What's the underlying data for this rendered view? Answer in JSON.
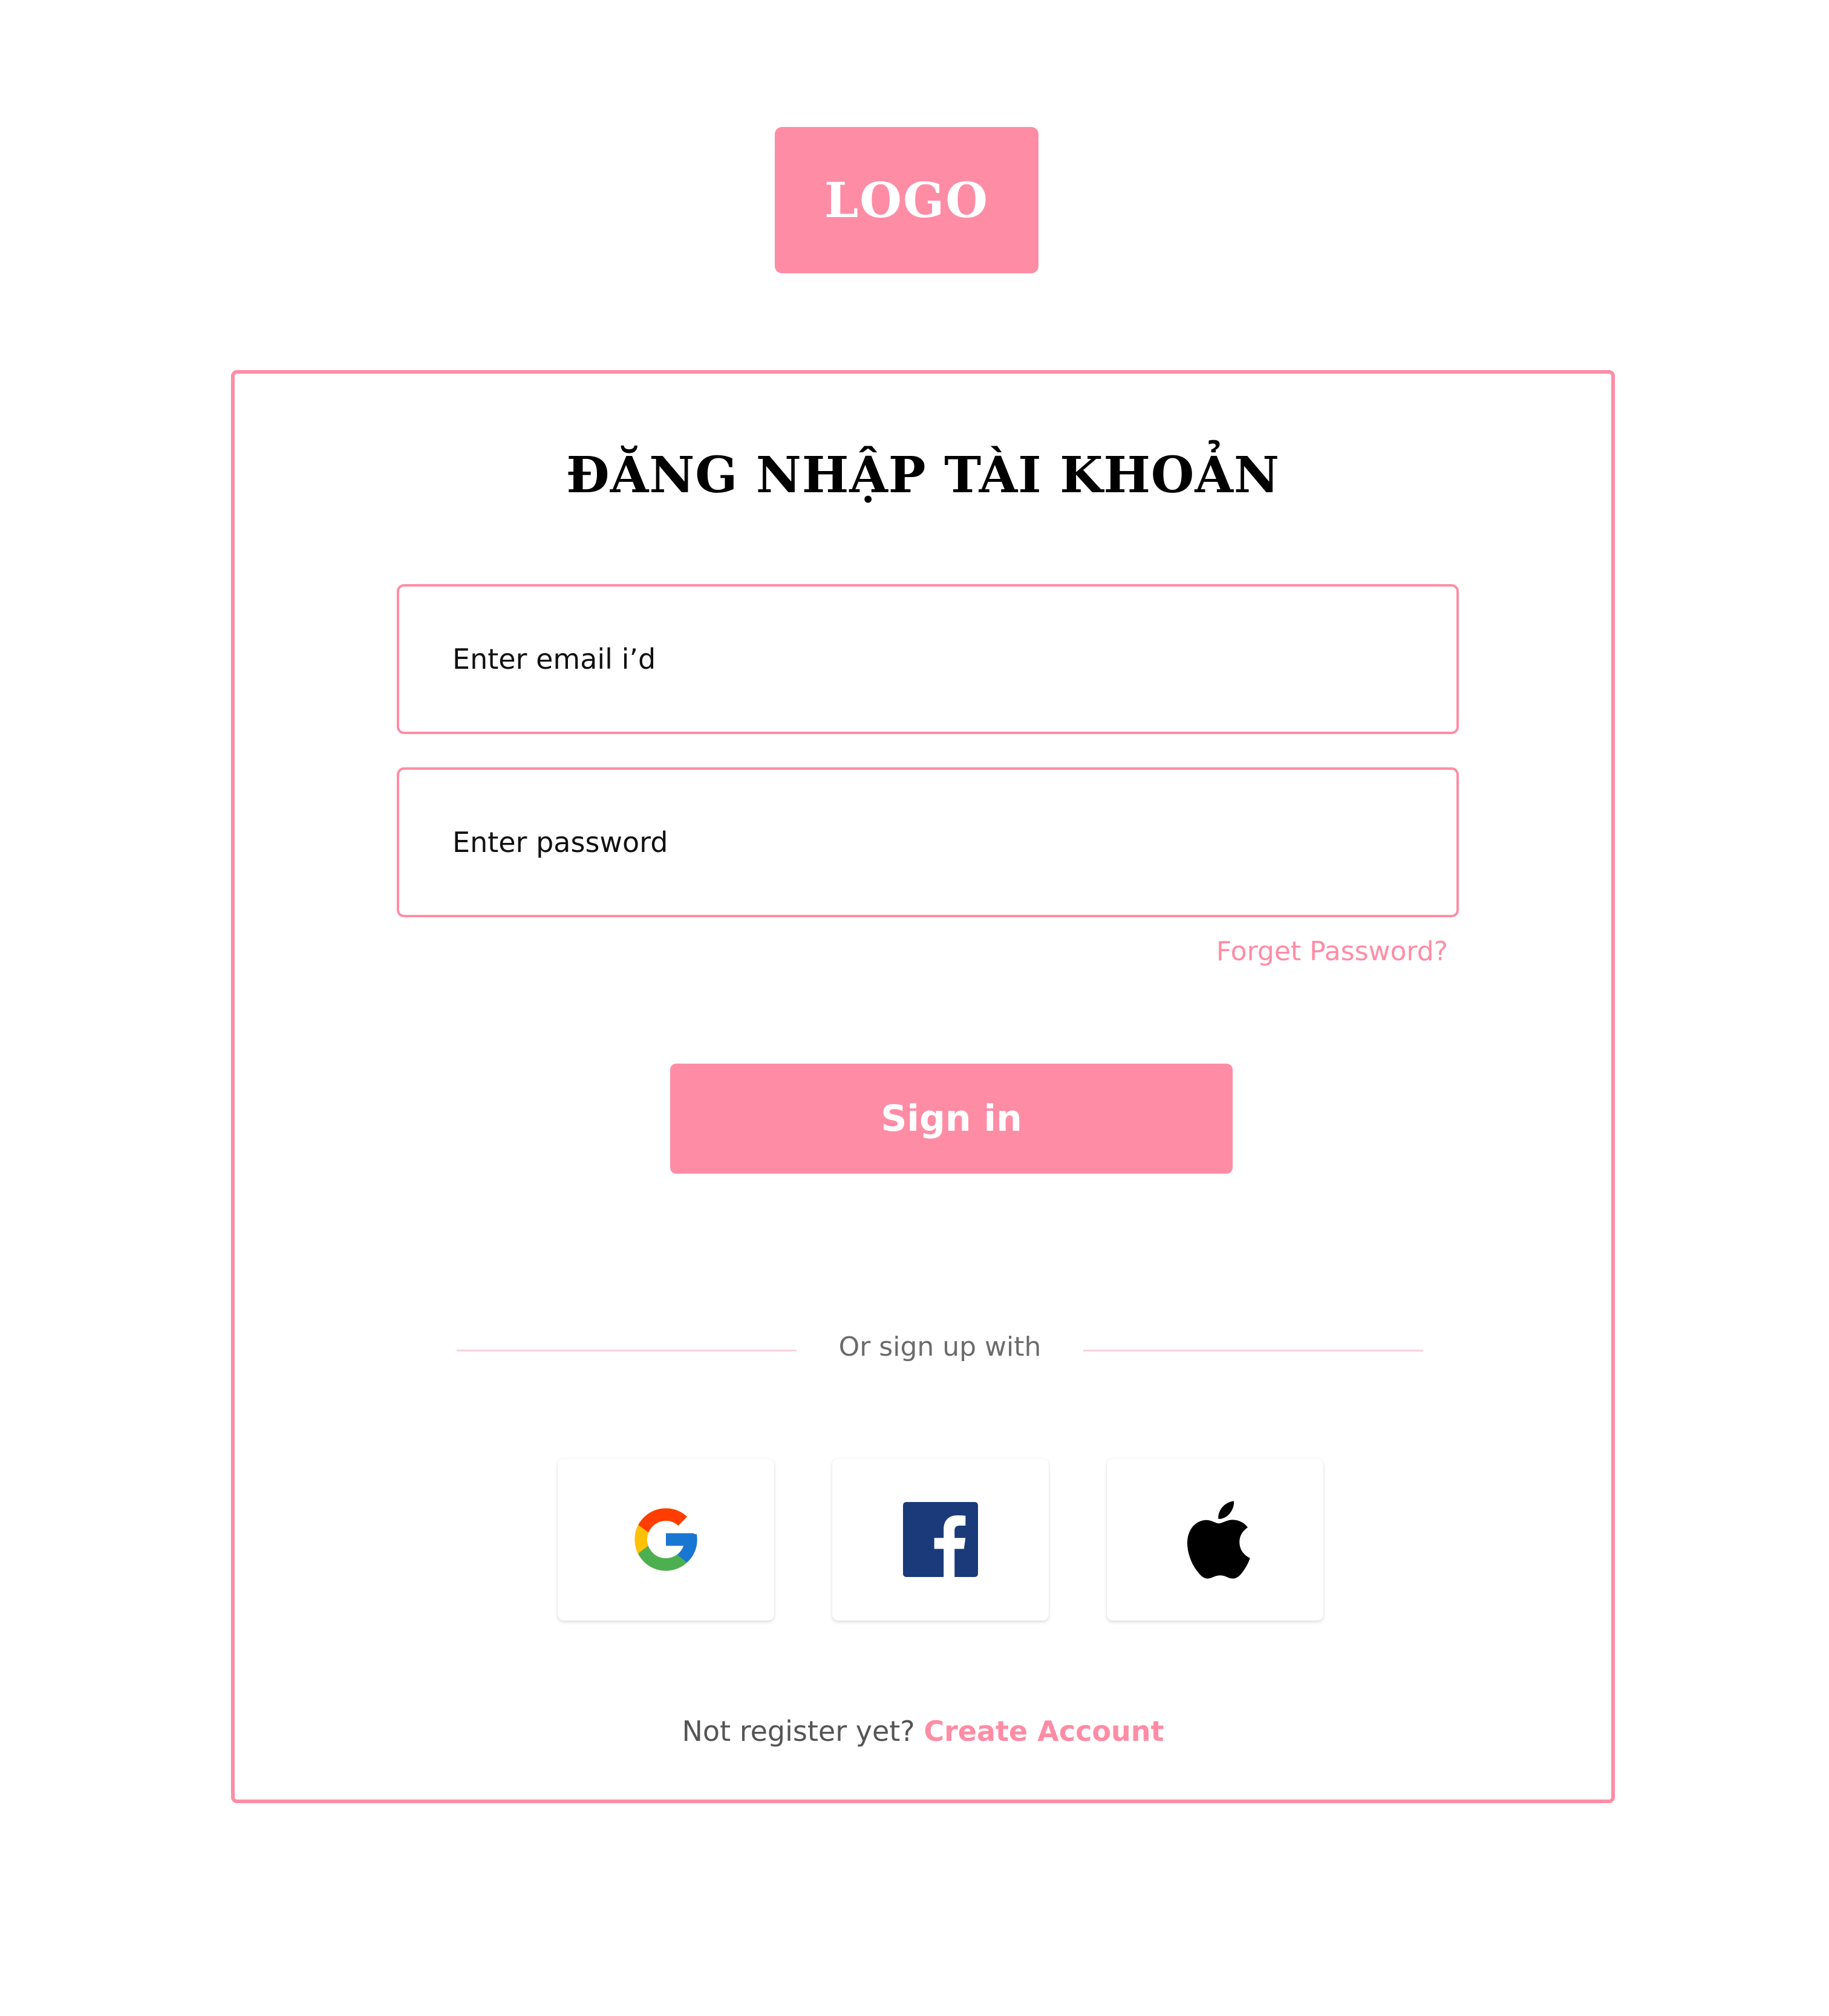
{
  "logo": {
    "text": "LOGO"
  },
  "login": {
    "title": "ĐĂNG NHẬP TÀI KHOẢN",
    "email_placeholder": "Enter email i’d",
    "password_placeholder": "Enter password",
    "forget_password": "Forget Password?",
    "sign_in": "Sign in",
    "divider_text": "Or sign up with",
    "social": [
      {
        "name": "google-icon"
      },
      {
        "name": "facebook-icon"
      },
      {
        "name": "apple-icon"
      }
    ],
    "footer_prompt": "Not register yet?",
    "create_account": "Create Account"
  },
  "colors": {
    "accent": "#ff8ca5",
    "divider": "#f6d2da",
    "muted_text": "#6b6b6b"
  }
}
